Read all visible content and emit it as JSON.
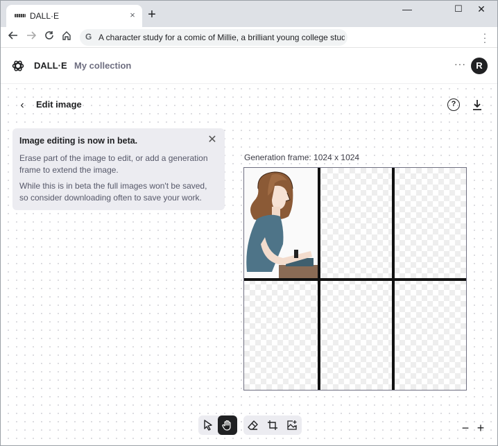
{
  "browser": {
    "tab_title": "DALL·E",
    "tab_close": "×",
    "new_tab": "+",
    "address_text": "A character study for a comic of Millie, a brilliant young college stud...",
    "search_icon_label": "G",
    "window_controls": {
      "minimize": "—",
      "maximize": "☐",
      "close": "✕"
    }
  },
  "appbar": {
    "brand": "DALL·E",
    "nav_collection": "My collection",
    "more": "···",
    "avatar_initial": "R"
  },
  "page": {
    "title": "Edit image",
    "back": "‹",
    "help": "?"
  },
  "banner": {
    "title": "Image editing is now in beta.",
    "paragraph1": "Erase part of the image to edit, or add a generation frame to extend the image.",
    "paragraph2": "While this is in beta the full images won't be saved, so consider downloading often to save your work.",
    "close": "✕"
  },
  "canvas": {
    "frame_label": "Generation frame: 1024 x 1024"
  },
  "tools": {
    "items": [
      "select-tool",
      "pan-tool",
      "eraser-tool",
      "add-frame-tool",
      "upload-image-tool"
    ],
    "active": "pan-tool"
  },
  "zoom": {
    "out": "−",
    "in": "+"
  }
}
